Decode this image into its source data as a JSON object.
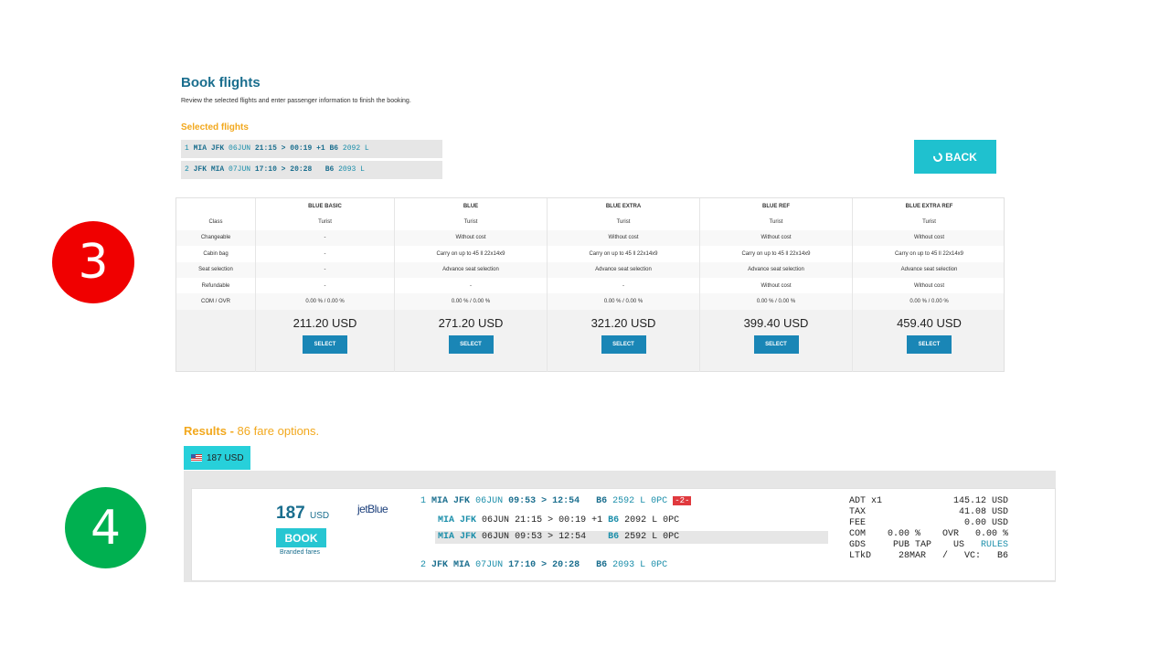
{
  "steps": {
    "three": "3",
    "four": "4"
  },
  "book": {
    "title": "Book flights",
    "subtitle": "Review the selected flights and enter passenger information to finish the booking.",
    "selected_title": "Selected flights",
    "segments": [
      {
        "num": "1",
        "route": "MIA JFK",
        "date": "06JUN",
        "times": "21:15 > 00:19 +1",
        "carrier": "B6",
        "flight": "2092 L"
      },
      {
        "num": "2",
        "route": "JFK MIA",
        "date": "07JUN",
        "times": "17:10 > 20:28  ",
        "carrier": "B6",
        "flight": "2093 L"
      }
    ],
    "back_label": "BACK"
  },
  "fare_table": {
    "columns": [
      "",
      "BLUE BASIC",
      "BLUE",
      "BLUE EXTRA",
      "BLUE REF",
      "BLUE EXTRA REF"
    ],
    "rows": [
      [
        "Class",
        "Turist",
        "Turist",
        "Turist",
        "Turist",
        "Turist"
      ],
      [
        "Changeable",
        "-",
        "Without cost",
        "Without cost",
        "Without cost",
        "Without cost"
      ],
      [
        "Cabin bag",
        "-",
        "Carry on up to 45 ll 22x14x9",
        "Carry on up to 45 ll 22x14x9",
        "Carry on up to 45 ll 22x14x9",
        "Carry on up to 45 ll 22x14x9"
      ],
      [
        "Seat selection",
        "-",
        "Advance seat selection",
        "Advance seat selection",
        "Advance seat selection",
        "Advance seat selection"
      ],
      [
        "Refundable",
        "-",
        "-",
        "-",
        "Without cost",
        "Without cost"
      ],
      [
        "COM / OVR",
        "0.00 % / 0.00 %",
        "0.00 % / 0.00 %",
        "0.00 % / 0.00 %",
        "0.00 % / 0.00 %",
        "0.00 % / 0.00 %"
      ]
    ],
    "prices": [
      "211.20 USD",
      "271.20 USD",
      "321.20 USD",
      "399.40 USD",
      "459.40 USD"
    ],
    "select_label": "SELECT"
  },
  "results": {
    "title": "Results -",
    "count": "86 fare options.",
    "tab_label": "187 USD",
    "total_value": "187",
    "total_currency": "USD",
    "book_label": "BOOK",
    "branded_label": "Branded fares",
    "airline": "jetBlue",
    "leg1": {
      "num": "1",
      "route": "MIA JFK",
      "date": "06JUN",
      "times": "09:53 > 12:54",
      "carrier": "B6",
      "flight": "2592 L 0PC",
      "badge": "-2-"
    },
    "leg1_sub_a": {
      "route": "MIA JFK",
      "date": "06JUN",
      "times": "21:15 > 00:19 +1",
      "carrier": "B6",
      "flight": "2092 L 0PC"
    },
    "leg1_sub_b": {
      "route": "MIA JFK",
      "date": "06JUN",
      "times": "09:53 > 12:54",
      "carrier": "B6",
      "flight": "2592 L 0PC"
    },
    "leg2": {
      "num": "2",
      "route": "JFK MIA",
      "date": "07JUN",
      "times": "17:10 > 20:28",
      "carrier": "B6",
      "flight": "2093 L 0PC"
    },
    "fare_info": {
      "line1": "ADT x1             145.12 USD",
      "line2": "TAX                 41.08 USD",
      "line3": "FEE                  0.00 USD",
      "line4": "COM    0.00 %    OVR   0.00 %",
      "line5_a": "GDS     PUB TAP    US   ",
      "rules": "RULES",
      "line6": "LTkD     28MAR   /   VC:   B6"
    }
  }
}
